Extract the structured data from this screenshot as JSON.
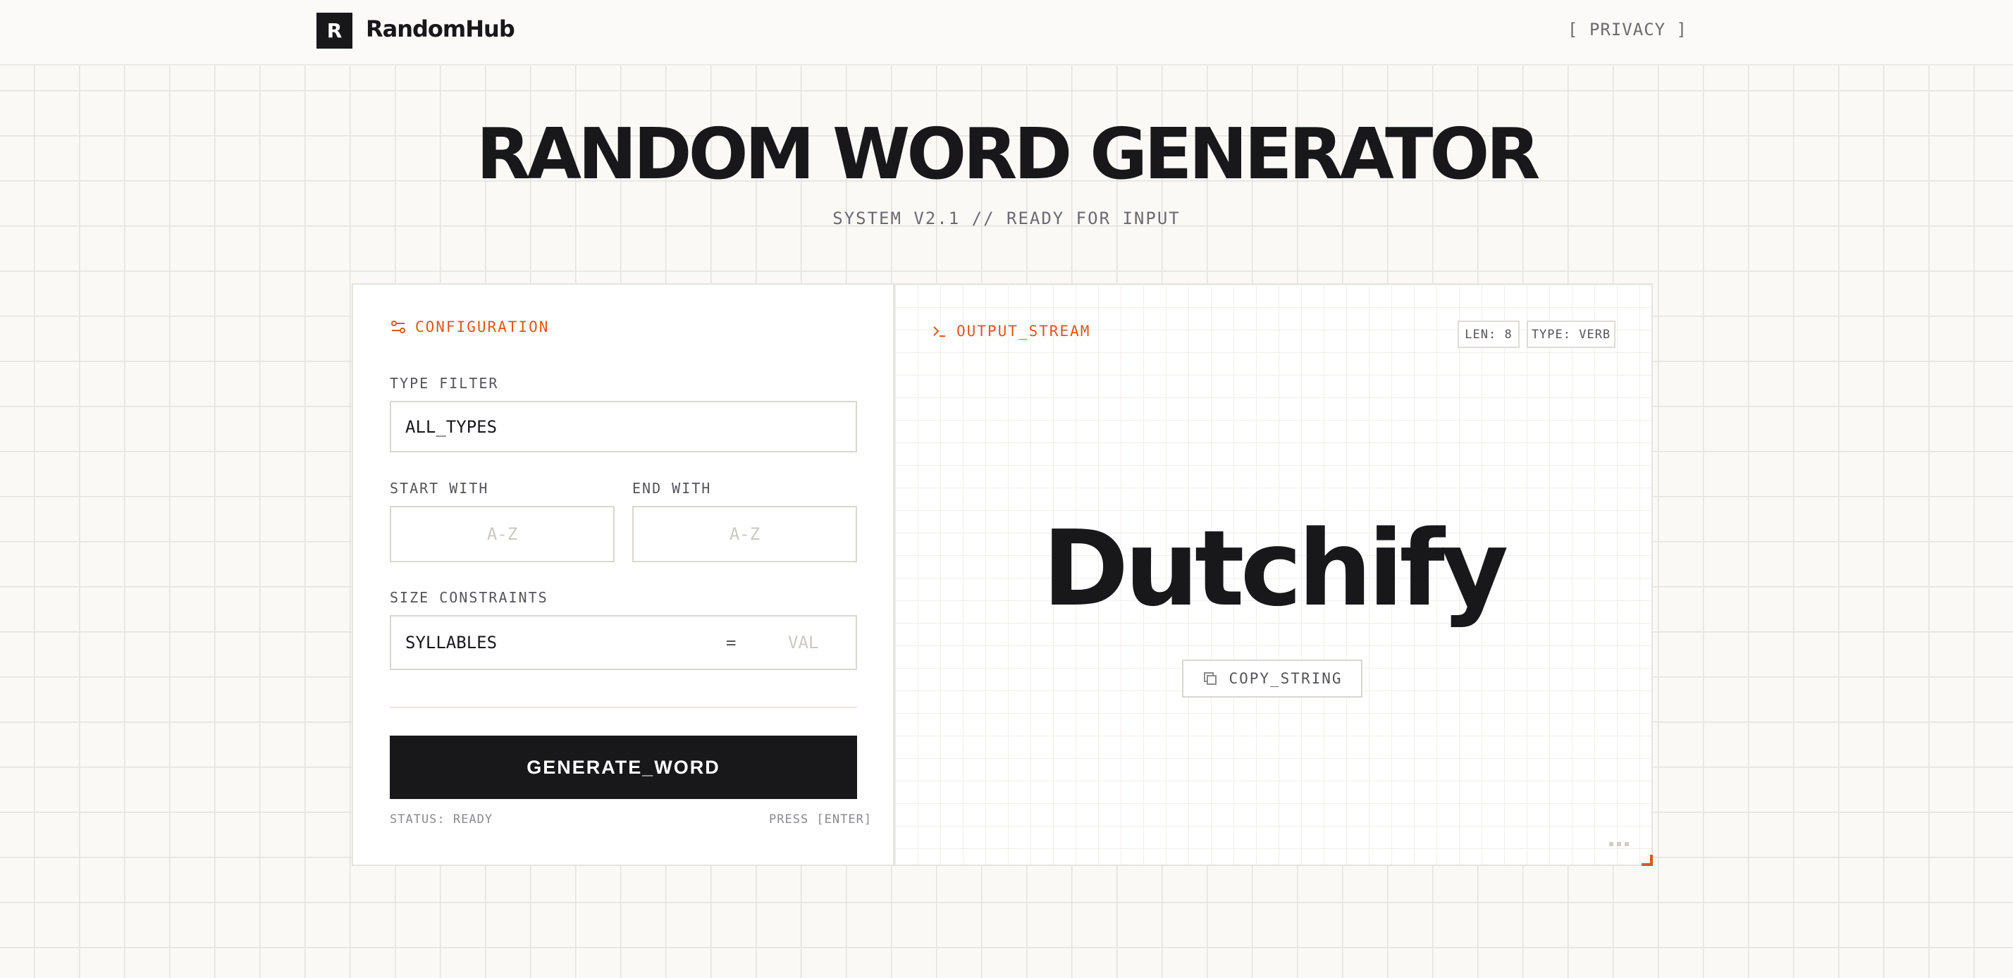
{
  "header": {
    "logo_letter": "R",
    "app_name": "RandomHub",
    "privacy_link": "[ PRIVACY ]"
  },
  "hero": {
    "title": "RANDOM WORD GENERATOR",
    "subtitle": "SYSTEM V2.1 // READY FOR INPUT"
  },
  "config": {
    "heading": "CONFIGURATION",
    "type_filter_label": "TYPE FILTER",
    "type_filter_value": "ALL_TYPES",
    "start_with_label": "START WITH",
    "start_with_placeholder": "A-Z",
    "end_with_label": "END WITH",
    "end_with_placeholder": "A-Z",
    "size_label": "SIZE CONSTRAINTS",
    "size_unit": "SYLLABLES",
    "size_operator": "=",
    "size_placeholder": "VAL",
    "generate_button": "GENERATE_WORD",
    "status": "STATUS: READY",
    "hint": "PRESS [ENTER]"
  },
  "output": {
    "heading": "OUTPUT_STREAM",
    "badge_len": "LEN: 8",
    "badge_type": "TYPE: VERB",
    "word": "Dutchify",
    "copy_button": "COPY_STRING"
  },
  "icons": {
    "config": "sliders-icon",
    "output": "terminal-icon",
    "copy": "copy-icon"
  },
  "colors": {
    "accent": "#e2561a",
    "dark": "#18181b",
    "background": "#faf9f6"
  }
}
